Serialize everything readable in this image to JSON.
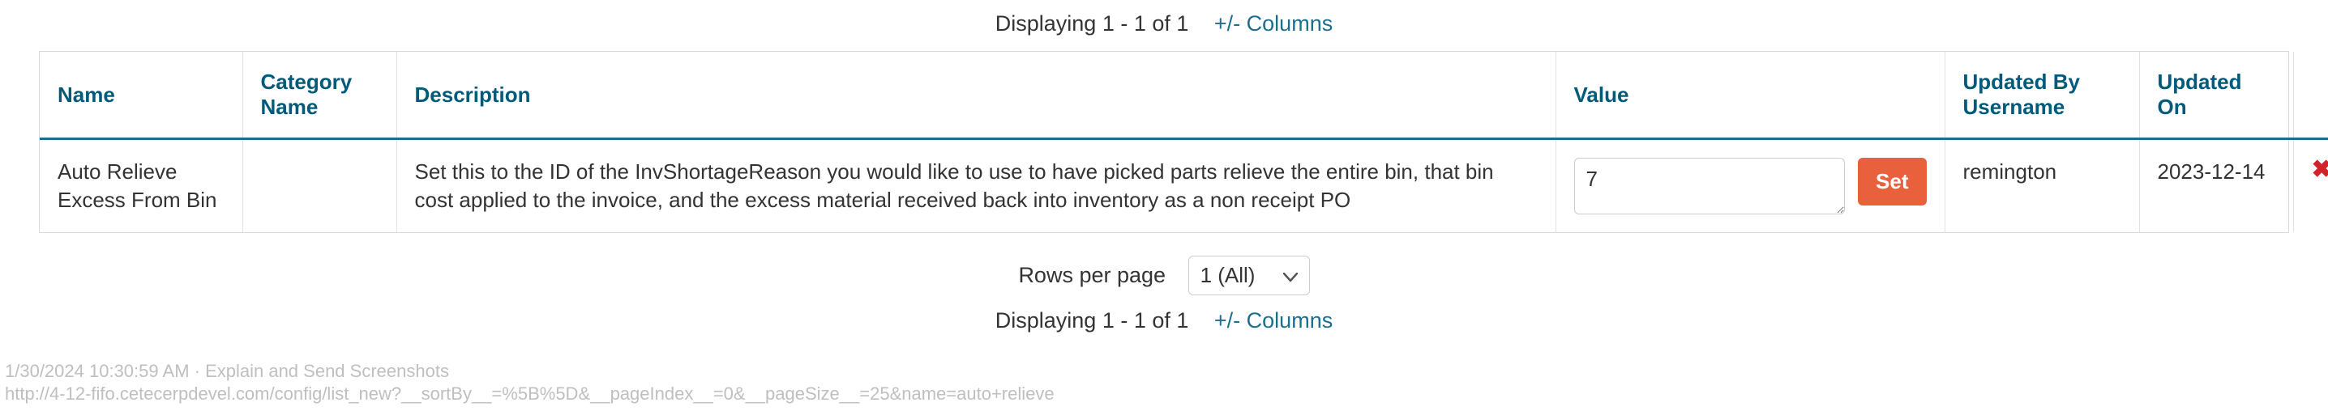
{
  "pager": {
    "display_text": "Displaying 1 - 1 of 1",
    "columns_link": "+/-  Columns"
  },
  "columns": {
    "name": "Name",
    "category": "Category Name",
    "description": "Description",
    "value": "Value",
    "updated_by": "Updated By Username",
    "updated_on": "Updated On"
  },
  "row": {
    "name": "Auto Relieve Excess From Bin",
    "category": "",
    "description": "Set this to the ID of the InvShortageReason you would like to use to have picked parts relieve the entire bin, that bin cost applied to the invoice, and the excess material received back into inventory as a non receipt PO",
    "value": "7",
    "set_label": "Set",
    "updated_by": "remington",
    "updated_on": "2023-12-14",
    "delete_icon": "✖"
  },
  "rows_per_page": {
    "label": "Rows per page",
    "selected": "1 (All)"
  },
  "watermark": {
    "line1": "1/30/2024 10:30:59 AM · Explain and Send Screenshots",
    "line2": "http://4-12-fifo.cetecerpdevel.com/config/list_new?__sortBy__=%5B%5D&__pageIndex__=0&__pageSize__=25&name=auto+relieve"
  }
}
